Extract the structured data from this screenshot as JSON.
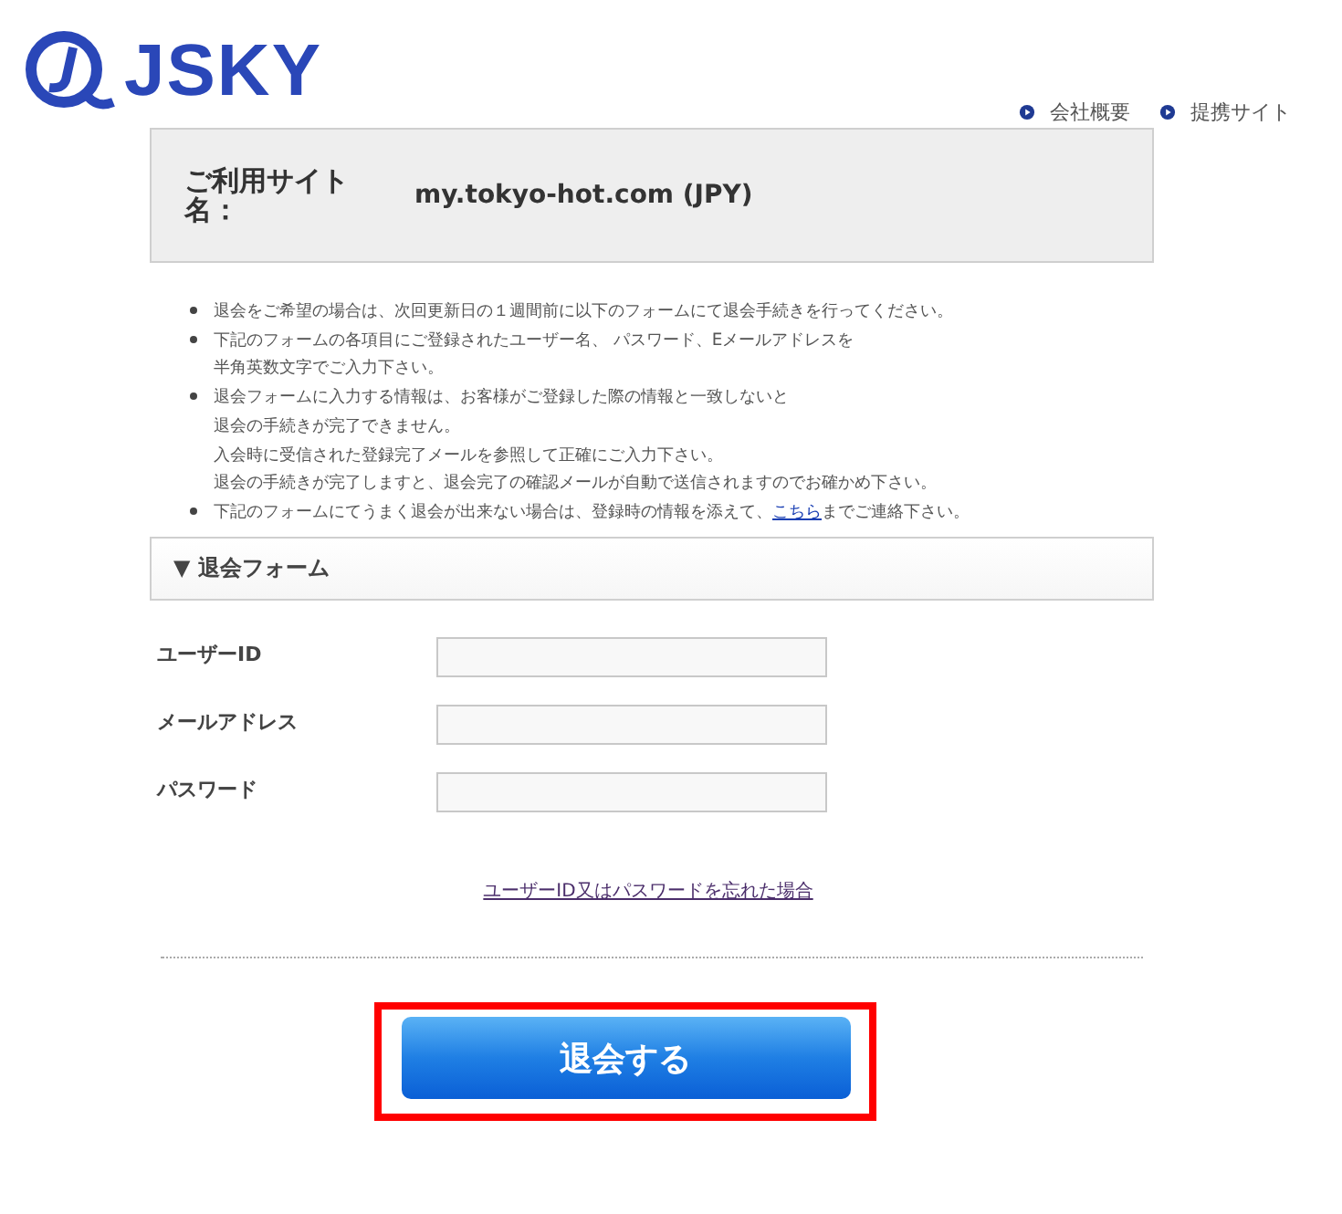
{
  "logo": {
    "text": "JSKY"
  },
  "nav": [
    {
      "label": "会社概要"
    },
    {
      "label": "提携サイト"
    }
  ],
  "site_box": {
    "label": "ご利用サイト名：",
    "value": "my.tokyo-hot.com (JPY)"
  },
  "notes": [
    {
      "lines": [
        "退会をご希望の場合は、次回更新日の１週間前に以下のフォームにて退会手続きを行ってください。"
      ]
    },
    {
      "lines": [
        "下記のフォームの各項目にご登録されたユーザー名、 パスワード、Eメールアドレスを",
        "半角英数文字でご入力下さい。"
      ]
    },
    {
      "lines": [
        "退会フォームに入力する情報は、お客様がご登録した際の情報と一致しないと",
        "退会の手続きが完了できません。",
        "入会時に受信された登録完了メールを参照して正確にご入力下さい。",
        "退会の手続きが完了しますと、退会完了の確認メールが自動で送信されますのでお確かめ下さい。"
      ]
    },
    {
      "lines": [
        "下記のフォームにてうまく退会が出来ない場合は、登録時の情報を添えて、"
      ],
      "link": "こちら",
      "after": "までご連絡下さい。"
    }
  ],
  "form": {
    "title": "▼ 退会フォーム",
    "fields": [
      {
        "label": "ユーザーID"
      },
      {
        "label": "メールアドレス"
      },
      {
        "label": "パスワード"
      }
    ],
    "forgot_link": "ユーザーID又はパスワードを忘れた場合",
    "submit": "退会する"
  }
}
